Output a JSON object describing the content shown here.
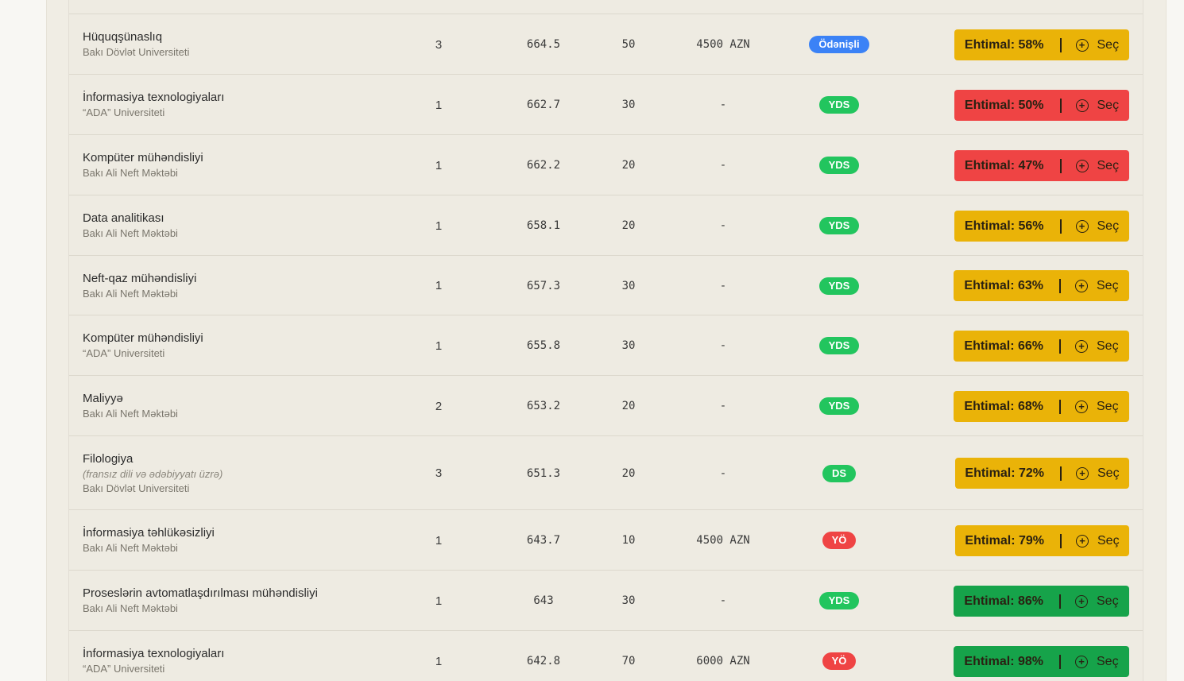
{
  "rows": [
    {
      "name": "Hüquqşünaslıq",
      "spec": "",
      "uni": "Bakı Dövlət Universiteti",
      "group": "3",
      "score": "664.5",
      "seats": "50",
      "fee": "4500 AZN",
      "type": "Ödənişli",
      "type_color": "#3b82f6",
      "prob": "Ehtimal: 58%",
      "prob_color": "#eab308",
      "select": "Seç"
    },
    {
      "name": "İnformasiya texnologiyaları",
      "spec": "",
      "uni": "“ADA” Universiteti",
      "group": "1",
      "score": "662.7",
      "seats": "30",
      "fee": "-",
      "type": "YDS",
      "type_color": "#22c55e",
      "prob": "Ehtimal: 50%",
      "prob_color": "#ef4444",
      "select": "Seç"
    },
    {
      "name": "Kompüter mühəndisliyi",
      "spec": "",
      "uni": "Bakı Ali Neft Məktəbi",
      "group": "1",
      "score": "662.2",
      "seats": "20",
      "fee": "-",
      "type": "YDS",
      "type_color": "#22c55e",
      "prob": "Ehtimal: 47%",
      "prob_color": "#ef4444",
      "select": "Seç"
    },
    {
      "name": "Data analitikası",
      "spec": "",
      "uni": "Bakı Ali Neft Məktəbi",
      "group": "1",
      "score": "658.1",
      "seats": "20",
      "fee": "-",
      "type": "YDS",
      "type_color": "#22c55e",
      "prob": "Ehtimal: 56%",
      "prob_color": "#eab308",
      "select": "Seç"
    },
    {
      "name": "Neft-qaz mühəndisliyi",
      "spec": "",
      "uni": "Bakı Ali Neft Məktəbi",
      "group": "1",
      "score": "657.3",
      "seats": "30",
      "fee": "-",
      "type": "YDS",
      "type_color": "#22c55e",
      "prob": "Ehtimal: 63%",
      "prob_color": "#eab308",
      "select": "Seç"
    },
    {
      "name": "Kompüter mühəndisliyi",
      "spec": "",
      "uni": "“ADA” Universiteti",
      "group": "1",
      "score": "655.8",
      "seats": "30",
      "fee": "-",
      "type": "YDS",
      "type_color": "#22c55e",
      "prob": "Ehtimal: 66%",
      "prob_color": "#eab308",
      "select": "Seç"
    },
    {
      "name": "Maliyyə",
      "spec": "",
      "uni": "Bakı Ali Neft Məktəbi",
      "group": "2",
      "score": "653.2",
      "seats": "20",
      "fee": "-",
      "type": "YDS",
      "type_color": "#22c55e",
      "prob": "Ehtimal: 68%",
      "prob_color": "#eab308",
      "select": "Seç"
    },
    {
      "name": "Filologiya",
      "spec": "(fransız dili və ədəbiyyatı üzrə)",
      "uni": "Bakı Dövlət Universiteti",
      "group": "3",
      "score": "651.3",
      "seats": "20",
      "fee": "-",
      "type": "DS",
      "type_color": "#22c55e",
      "prob": "Ehtimal: 72%",
      "prob_color": "#eab308",
      "select": "Seç"
    },
    {
      "name": "İnformasiya təhlükəsizliyi",
      "spec": "",
      "uni": "Bakı Ali Neft Məktəbi",
      "group": "1",
      "score": "643.7",
      "seats": "10",
      "fee": "4500 AZN",
      "type": "YÖ",
      "type_color": "#ef4444",
      "prob": "Ehtimal: 79%",
      "prob_color": "#eab308",
      "select": "Seç"
    },
    {
      "name": "Proseslərin avtomatlaşdırılması mühəndisliyi",
      "spec": "",
      "uni": "Bakı Ali Neft Məktəbi",
      "group": "1",
      "score": "643",
      "seats": "30",
      "fee": "-",
      "type": "YDS",
      "type_color": "#22c55e",
      "prob": "Ehtimal: 86%",
      "prob_color": "#16a34a",
      "select": "Seç"
    },
    {
      "name": "İnformasiya texnologiyaları",
      "spec": "",
      "uni": "“ADA” Universiteti",
      "group": "1",
      "score": "642.8",
      "seats": "70",
      "fee": "6000 AZN",
      "type": "YÖ",
      "type_color": "#ef4444",
      "prob": "Ehtimal: 98%",
      "prob_color": "#16a34a",
      "select": "Seç"
    }
  ]
}
